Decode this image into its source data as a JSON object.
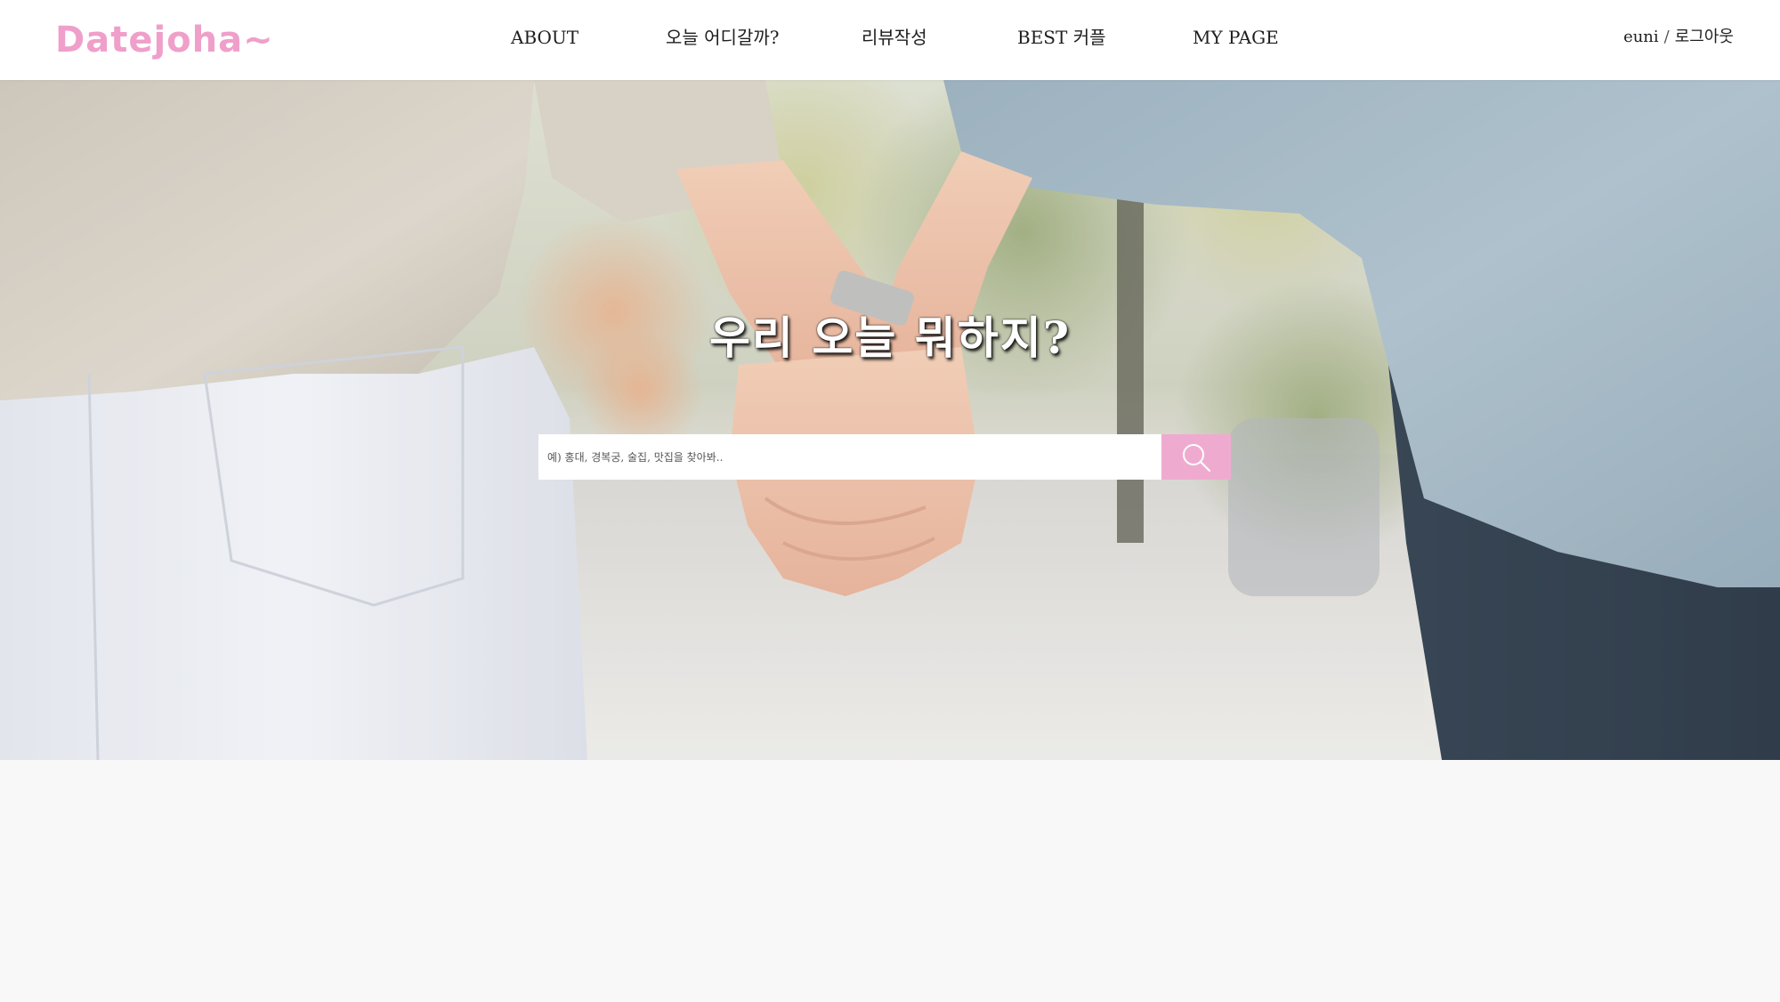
{
  "header": {
    "logo": "Datejoha~",
    "nav": [
      {
        "label": "ABOUT"
      },
      {
        "label": "오늘 어디갈까?"
      },
      {
        "label": "리뷰작성"
      },
      {
        "label": "BEST 커플"
      },
      {
        "label": "MY PAGE"
      }
    ],
    "user": {
      "name": "euni",
      "separator": "/",
      "logout_label": "로그아웃"
    }
  },
  "hero": {
    "title": "우리 오늘 뭐하지?",
    "search": {
      "placeholder": "예) 홍대, 경복궁, 술집, 맛집을 찾아봐..",
      "value": "",
      "button_icon": "search-icon"
    }
  },
  "colors": {
    "brand_pink": "#ef9fca",
    "search_button": "#efabcf",
    "header_bg": "#ffffff",
    "page_bg": "#f8f8f8"
  }
}
